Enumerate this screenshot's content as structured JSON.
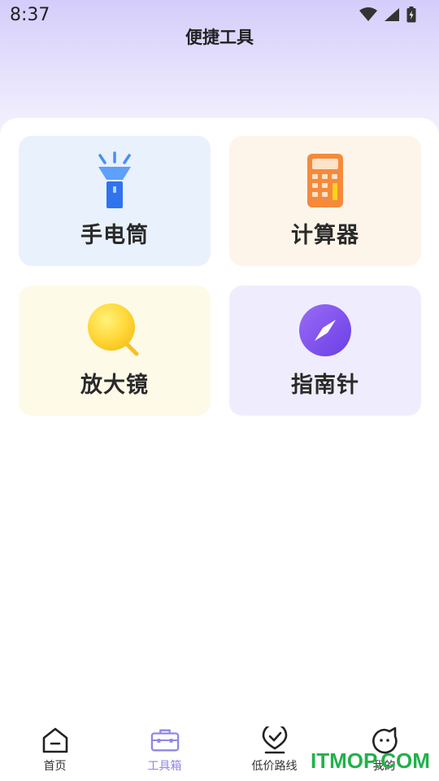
{
  "status_bar": {
    "time": "8:37"
  },
  "header": {
    "title": "便捷工具"
  },
  "tools": [
    {
      "label": "手电筒",
      "icon": "flashlight-icon",
      "bg": "#e9f1fd"
    },
    {
      "label": "计算器",
      "icon": "calculator-icon",
      "bg": "#fdf5ea"
    },
    {
      "label": "放大镜",
      "icon": "magnifier-icon",
      "bg": "#fefae8"
    },
    {
      "label": "指南针",
      "icon": "compass-icon",
      "bg": "#efedfd"
    }
  ],
  "nav": {
    "items": [
      {
        "label": "首页",
        "icon": "home-icon"
      },
      {
        "label": "工具箱",
        "icon": "toolbox-icon",
        "active": true
      },
      {
        "label": "低价路线",
        "icon": "location-check-icon"
      },
      {
        "label": "我的",
        "icon": "profile-face-icon"
      }
    ],
    "active_color": "#8f86e6"
  },
  "watermark": "ITMOP.COM"
}
